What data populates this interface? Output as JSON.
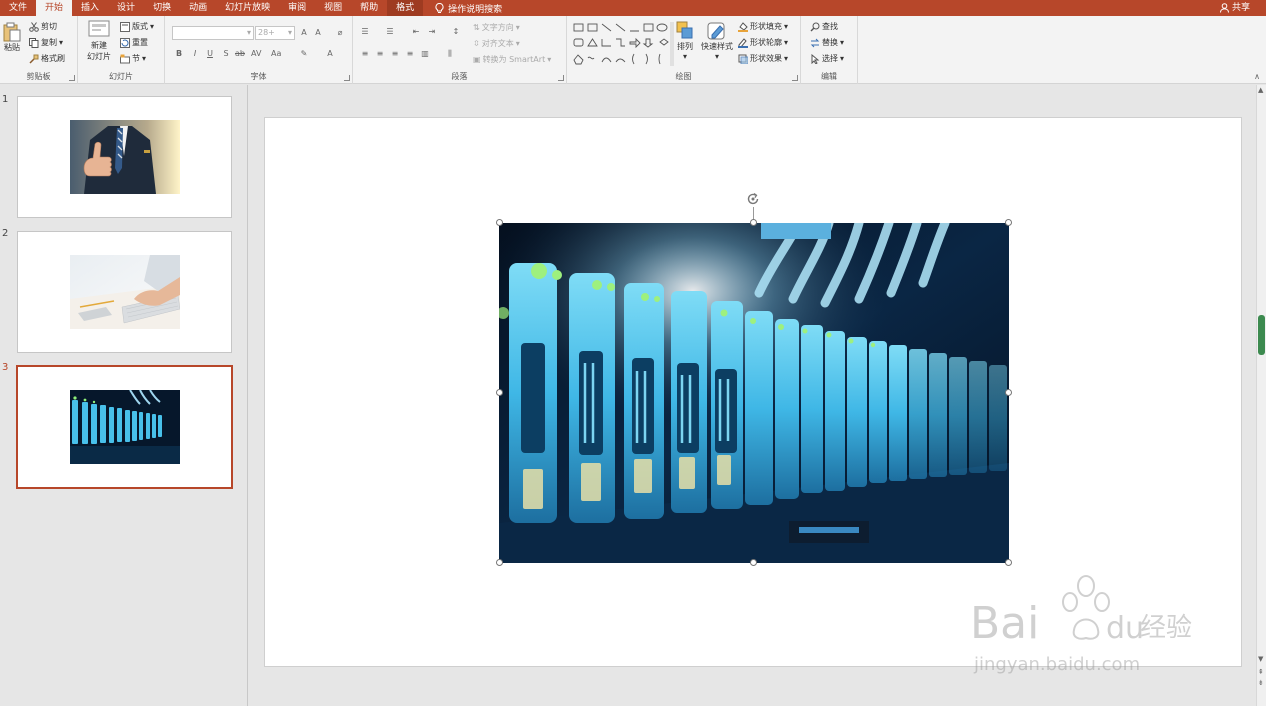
{
  "tabs": [
    {
      "label": "文件",
      "active": false
    },
    {
      "label": "开始",
      "active": true
    },
    {
      "label": "插入",
      "active": false
    },
    {
      "label": "设计",
      "active": false
    },
    {
      "label": "切换",
      "active": false
    },
    {
      "label": "动画",
      "active": false
    },
    {
      "label": "幻灯片放映",
      "active": false
    },
    {
      "label": "审阅",
      "active": false
    },
    {
      "label": "视图",
      "active": false
    },
    {
      "label": "帮助",
      "active": false
    },
    {
      "label": "格式",
      "active": false
    }
  ],
  "tell_me": "操作说明搜索",
  "share": "共享",
  "ribbon": {
    "clipboard": {
      "label": "剪贴板",
      "paste": "粘贴",
      "cut": "剪切",
      "copy": "复制",
      "format_painter": "格式刷"
    },
    "slides": {
      "label": "幻灯片",
      "new_slide_line1": "新建",
      "new_slide_line2": "幻灯片",
      "layout": "版式",
      "reset": "重置",
      "section": "节"
    },
    "font": {
      "label": "字体",
      "size": "28+"
    },
    "paragraph": {
      "label": "段落",
      "text_direction": "文字方向",
      "align_text": "对齐文本",
      "smartart": "转换为 SmartArt"
    },
    "drawing": {
      "label": "绘图",
      "arrange": "排列",
      "quick_styles": "快速样式",
      "shape_fill": "形状填充",
      "shape_outline": "形状轮廓",
      "shape_effects": "形状效果"
    },
    "editing": {
      "label": "编辑",
      "find": "查找",
      "replace": "替换",
      "select": "选择"
    }
  },
  "slides": [
    {
      "number": "1",
      "selected": false,
      "image": "businessman-thumbs-up"
    },
    {
      "number": "2",
      "selected": false,
      "image": "hands-typing-keyboard"
    },
    {
      "number": "3",
      "selected": true,
      "image": "server-rack"
    }
  ],
  "watermark": {
    "brand": "Bai",
    "brand2": "du",
    "cn": "经验",
    "url": "jingyan.baidu.com"
  },
  "colors": {
    "accent": "#b7472a",
    "ribbon_bg": "#f3f3f3",
    "canvas_bg": "#e6e6e6"
  }
}
